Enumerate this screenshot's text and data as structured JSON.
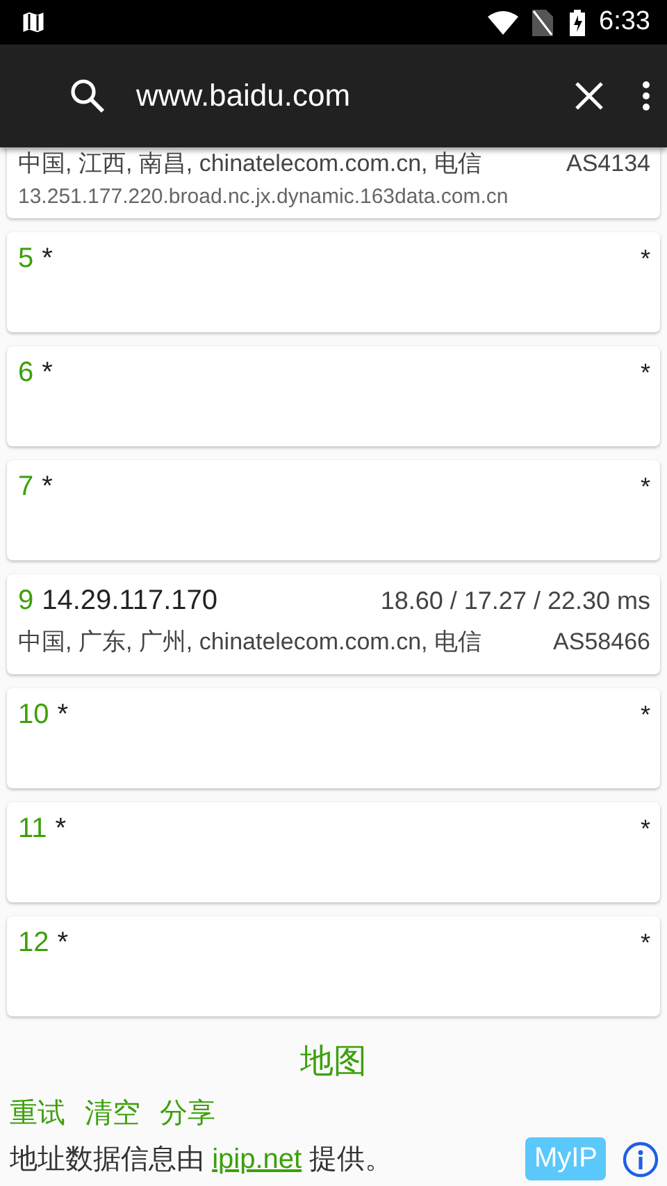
{
  "status_bar": {
    "time": "6:33"
  },
  "toolbar": {
    "query": "www.baidu.com"
  },
  "hops": [
    {
      "kind": "partial",
      "location": "中国, 江西, 南昌, chinatelecom.com.cn, 电信",
      "asn": "AS4134",
      "host": "13.251.177.220.broad.nc.jx.dynamic.163data.com.cn"
    },
    {
      "kind": "timeout",
      "number": "5",
      "address": "*",
      "time": "*"
    },
    {
      "kind": "timeout",
      "number": "6",
      "address": "*",
      "time": "*"
    },
    {
      "kind": "timeout",
      "number": "7",
      "address": "*",
      "time": "*"
    },
    {
      "kind": "reply",
      "number": "9",
      "address": "14.29.117.170",
      "time": "18.60 / 17.27 / 22.30 ms",
      "location": "中国, 广东, 广州, chinatelecom.com.cn, 电信",
      "asn": "AS58466"
    },
    {
      "kind": "timeout",
      "number": "10",
      "address": "*",
      "time": "*"
    },
    {
      "kind": "timeout",
      "number": "11",
      "address": "*",
      "time": "*"
    },
    {
      "kind": "timeout",
      "number": "12",
      "address": "*",
      "time": "*"
    }
  ],
  "map_link": "地图",
  "actions": [
    "重试",
    "清空",
    "分享"
  ],
  "footer": {
    "prefix": "地址数据信息由",
    "link": "ipip.net",
    "suffix": "提供。",
    "myip_button": "MyIP"
  }
}
